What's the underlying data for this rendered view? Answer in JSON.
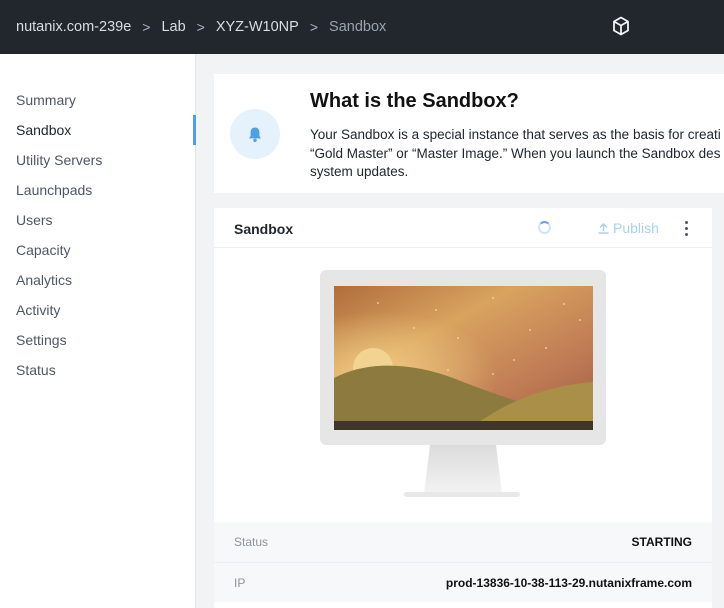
{
  "breadcrumb": {
    "items": [
      {
        "label": "nutanix.com-239e"
      },
      {
        "label": "Lab"
      },
      {
        "label": "XYZ-W10NP"
      },
      {
        "label": "Sandbox"
      }
    ],
    "separator": ">"
  },
  "header": {
    "icon": "cube-icon"
  },
  "sidebar": {
    "items": [
      {
        "label": "Summary"
      },
      {
        "label": "Sandbox",
        "active": true
      },
      {
        "label": "Utility Servers"
      },
      {
        "label": "Launchpads"
      },
      {
        "label": "Users"
      },
      {
        "label": "Capacity"
      },
      {
        "label": "Analytics"
      },
      {
        "label": "Activity"
      },
      {
        "label": "Settings"
      },
      {
        "label": "Status"
      }
    ]
  },
  "info": {
    "icon": "bell-icon",
    "title": "What is the Sandbox?",
    "text": "Your Sandbox is a special instance that serves as the basis for creati “Gold Master” or “Master Image.” When you launch the Sandbox des system updates."
  },
  "sandbox": {
    "title": "Sandbox",
    "publish_label": "Publish",
    "status_label": "Status",
    "status_value": "STARTING",
    "ip_label": "IP",
    "ip_value": "prod-13836-10-38-113-29.nutanixframe.com"
  },
  "colors": {
    "topbar": "#22272e",
    "accent": "#4f9fe3",
    "publish_disabled": "#a9d0f1"
  }
}
